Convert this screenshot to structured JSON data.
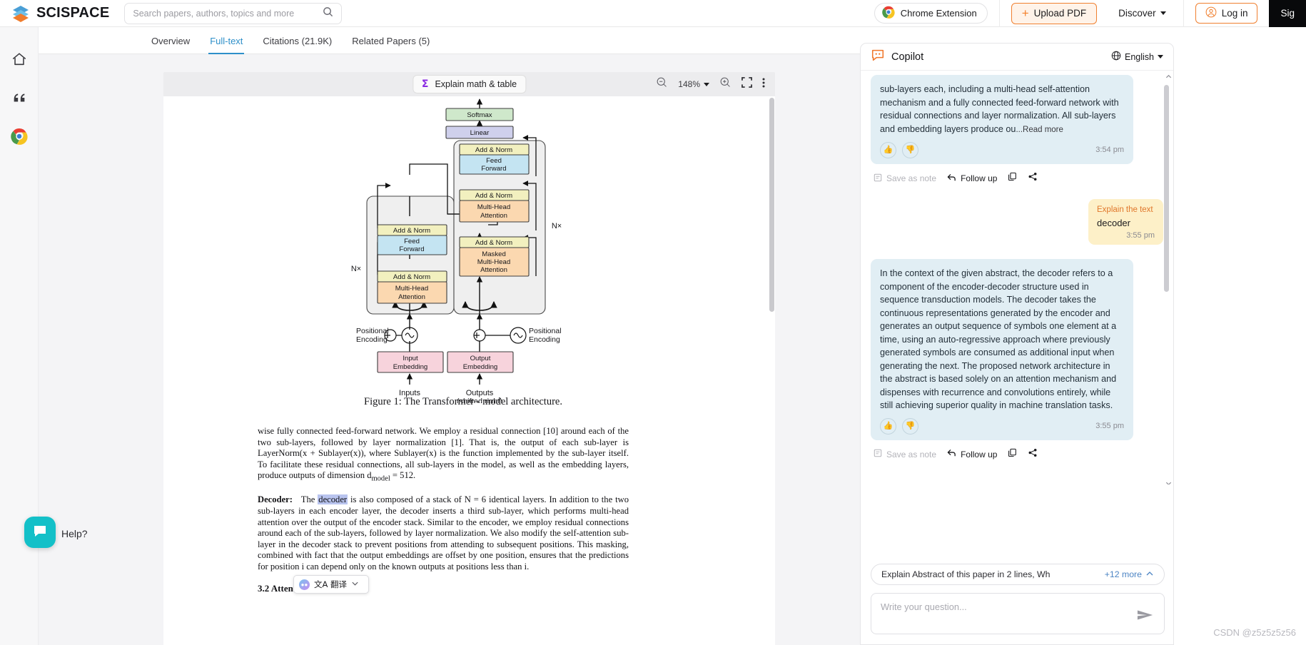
{
  "header": {
    "brand": "SCISPACE",
    "search_placeholder": "Search papers, authors, topics and more",
    "search_value": "",
    "chrome_extension": "Chrome Extension",
    "upload_pdf": "Upload PDF",
    "upload_plus": "+",
    "discover": "Discover",
    "log_in": "Log in",
    "sign_up": "Sig",
    "accent": "#f4812b"
  },
  "tabs": [
    {
      "label": "Overview",
      "active": false
    },
    {
      "label": "Full-text",
      "active": true
    },
    {
      "label": "Citations (21.9K)",
      "active": false
    },
    {
      "label": "Related Papers (5)",
      "active": false
    }
  ],
  "pdf_toolbar": {
    "explain_math": "Explain math & table",
    "zoom_level": "148%",
    "zoom_out_icon": "zoom-out-icon",
    "zoom_in_icon": "zoom-in-icon",
    "fullscreen_icon": "fullscreen-icon",
    "more_icon": "more-options-icon"
  },
  "paper": {
    "figure_caption": "Figure 1: The Transformer - model architecture.",
    "paragraph_1": "wise fully connected feed-forward network. We employ a residual connection [10] around each of the two sub-layers, followed by layer normalization [1]. That is, the output of each sub-layer is LayerNorm(x + Sublayer(x)), where Sublayer(x) is the function implemented by the sub-layer itself. To facilitate these residual connections, all sub-layers in the model, as well as the embedding layers, produce outputs of dimension d",
    "paragraph_1_sub": "model",
    "paragraph_1_tail": " = 512.",
    "decoder_head": "Decoder:",
    "decoder_p_a": "The ",
    "decoder_highlight": "decoder",
    "decoder_p_b": " is also composed of a stack of N = 6 identical layers. In addition to the two sub-layers in each encoder layer, the decoder inserts a third sub-layer, which performs multi-head attention over the output of the encoder stack. Similar to the encoder, we employ residual connections around each of the sub-layers, followed by layer normalization. We also modify the self-attention sub-layer in the decoder stack to prevent positions from attending to subsequent positions. This masking, combined with fact that the output embeddings are offset by one position, ensures that the predictions for position i can depend only on the known outputs at positions less than i.",
    "next_section": "3.2   Attention",
    "translate_popup": "文A 翻译"
  },
  "diagram": {
    "softmax": "Softmax",
    "linear": "Linear",
    "add_norm": "Add & Norm",
    "feed_forward": "Feed\nForward",
    "multi_head_attention": "Multi-Head\nAttention",
    "masked_multi_head_attention": "Masked\nMulti-Head\nAttention",
    "input_embedding": "Input\nEmbedding",
    "output_embedding": "Output\nEmbedding",
    "positional_encoding": "Positional\nEncoding",
    "inputs": "Inputs",
    "outputs": "Outputs",
    "outputs_sub": "(shifted right)",
    "nx": "N×",
    "colors": {
      "softmax": "#cfe8cb",
      "linear": "#cfd0ec",
      "add_norm": "#f2f0bf",
      "feed_forward": "#c4e4f2",
      "attention": "#fbd8b0",
      "embedding": "#f7d3dc",
      "block_bg": "#efefef"
    }
  },
  "copilot": {
    "title": "Copilot",
    "language": "English",
    "globe_icon": "globe-icon",
    "bot_icon": "copilot-bot-icon",
    "messages": [
      {
        "role": "bot",
        "text": "sub-layers each, including a multi-head self-attention mechanism and a fully connected feed-forward network with residual connections and layer normalization. All sub-layers and embedding layers produce ou",
        "read_more": "...Read more",
        "time": "3:54 pm",
        "truncated": true
      },
      {
        "role": "user",
        "label": "Explain the text",
        "text": "decoder",
        "time": "3:55 pm"
      },
      {
        "role": "bot",
        "text": "In the context of the given abstract, the decoder refers to a component of the encoder-decoder structure used in sequence transduction models. The decoder takes the continuous representations generated by the encoder and generates an output sequence of symbols one element at a time, using an auto-regressive approach where previously generated symbols are consumed as additional input when generating the next. The proposed network architecture in the abstract is based solely on an attention mechanism and dispenses with recurrence and convolutions entirely, while still achieving superior quality in machine translation tasks.",
        "time": "3:55 pm",
        "truncated": false
      }
    ],
    "actions": {
      "save_as_note": "Save as note",
      "follow_up": "Follow up",
      "copy_icon": "copy-icon",
      "share_icon": "share-icon",
      "thumbs_up_icon": "thumbs-up-icon",
      "thumbs_down_icon": "thumbs-down-icon"
    },
    "suggestion": {
      "text": "Explain Abstract of this paper in 2 lines, Wh",
      "more": "+12 more"
    },
    "input": {
      "placeholder": "Write your question...",
      "value": "",
      "send_icon": "send-icon"
    }
  },
  "rail": {
    "items": [
      {
        "name": "home-icon"
      },
      {
        "name": "quote-icon"
      },
      {
        "name": "chrome-icon"
      }
    ]
  },
  "help": {
    "label": "Help?",
    "icon": "chat-bubble-icon",
    "color": "#13c0c8"
  },
  "watermark": "CSDN @z5z5z5z56"
}
